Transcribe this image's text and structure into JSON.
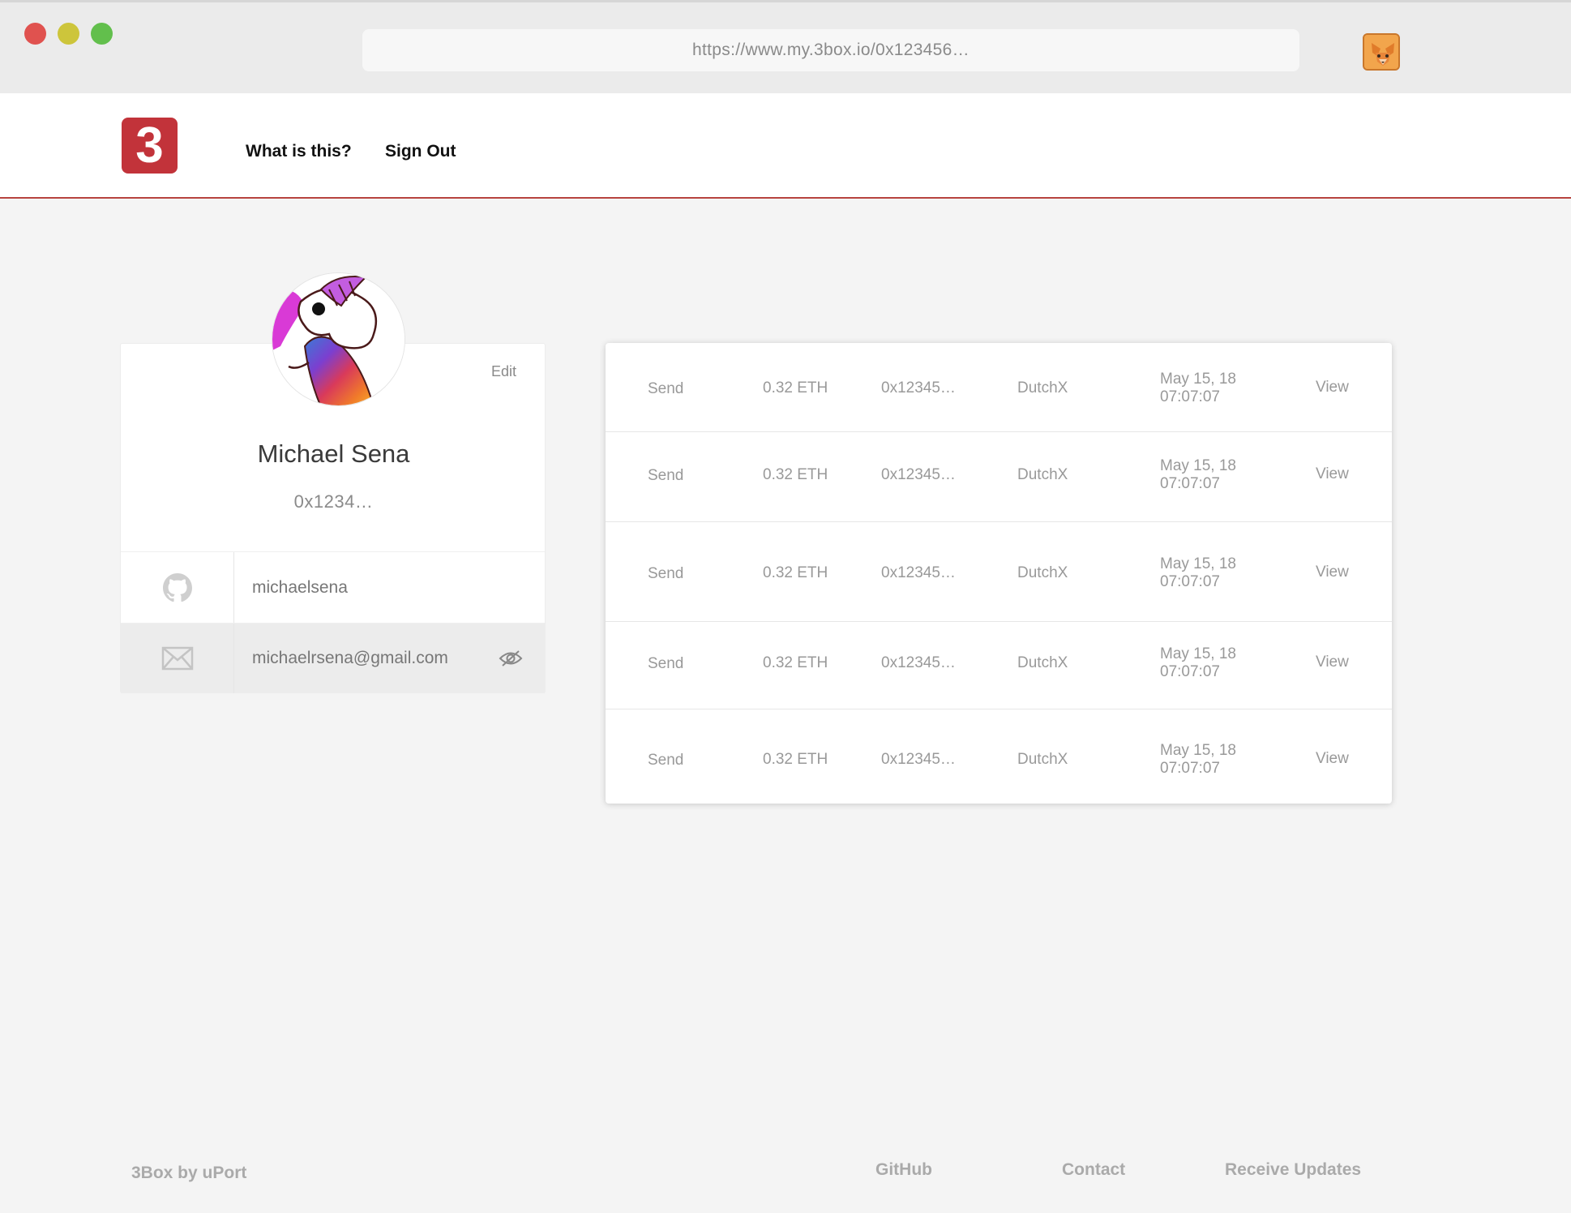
{
  "browser": {
    "url": "https://www.my.3box.io/0x123456…",
    "extension_icon": "metamask-fox-icon"
  },
  "header": {
    "logo_text": "3",
    "nav": [
      "What is this?",
      "Sign Out"
    ]
  },
  "profile": {
    "edit_label": "Edit",
    "name": "Michael Sena",
    "address": "0x1234…",
    "github": "michaelsena",
    "email": "michaelrsena@gmail.com",
    "icons": [
      "github-icon",
      "mail-icon",
      "eye-hidden-icon"
    ]
  },
  "transactions": [
    {
      "type": "Send",
      "amount": "0.32 ETH",
      "address": "0x12345…",
      "app": "DutchX",
      "date": "May 15, 18",
      "time": "07:07:07",
      "action": "View"
    },
    {
      "type": "Send",
      "amount": "0.32 ETH",
      "address": "0x12345…",
      "app": "DutchX",
      "date": "May 15, 18",
      "time": "07:07:07",
      "action": "View"
    },
    {
      "type": "Send",
      "amount": "0.32 ETH",
      "address": "0x12345…",
      "app": "DutchX",
      "date": "May 15, 18",
      "time": "07:07:07",
      "action": "View"
    },
    {
      "type": "Send",
      "amount": "0.32 ETH",
      "address": "0x12345…",
      "app": "DutchX",
      "date": "May 15, 18",
      "time": "07:07:07",
      "action": "View"
    },
    {
      "type": "Send",
      "amount": "0.32 ETH",
      "address": "0x12345…",
      "app": "DutchX",
      "date": "May 15, 18",
      "time": "07:07:07",
      "action": "View"
    }
  ],
  "footer": {
    "brand": "3Box by uPort",
    "links": [
      "GitHub",
      "Contact",
      "Receive Updates"
    ]
  },
  "colors": {
    "brand_red": "#c2333a",
    "header_border": "#b7443f",
    "page_bg": "#f4f4f4"
  }
}
